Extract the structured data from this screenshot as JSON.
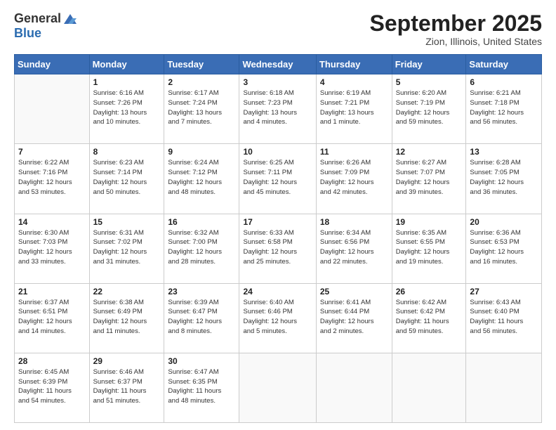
{
  "logo": {
    "general": "General",
    "blue": "Blue"
  },
  "title": "September 2025",
  "location": "Zion, Illinois, United States",
  "days_of_week": [
    "Sunday",
    "Monday",
    "Tuesday",
    "Wednesday",
    "Thursday",
    "Friday",
    "Saturday"
  ],
  "weeks": [
    [
      {
        "day": "",
        "info": ""
      },
      {
        "day": "1",
        "info": "Sunrise: 6:16 AM\nSunset: 7:26 PM\nDaylight: 13 hours\nand 10 minutes."
      },
      {
        "day": "2",
        "info": "Sunrise: 6:17 AM\nSunset: 7:24 PM\nDaylight: 13 hours\nand 7 minutes."
      },
      {
        "day": "3",
        "info": "Sunrise: 6:18 AM\nSunset: 7:23 PM\nDaylight: 13 hours\nand 4 minutes."
      },
      {
        "day": "4",
        "info": "Sunrise: 6:19 AM\nSunset: 7:21 PM\nDaylight: 13 hours\nand 1 minute."
      },
      {
        "day": "5",
        "info": "Sunrise: 6:20 AM\nSunset: 7:19 PM\nDaylight: 12 hours\nand 59 minutes."
      },
      {
        "day": "6",
        "info": "Sunrise: 6:21 AM\nSunset: 7:18 PM\nDaylight: 12 hours\nand 56 minutes."
      }
    ],
    [
      {
        "day": "7",
        "info": "Sunrise: 6:22 AM\nSunset: 7:16 PM\nDaylight: 12 hours\nand 53 minutes."
      },
      {
        "day": "8",
        "info": "Sunrise: 6:23 AM\nSunset: 7:14 PM\nDaylight: 12 hours\nand 50 minutes."
      },
      {
        "day": "9",
        "info": "Sunrise: 6:24 AM\nSunset: 7:12 PM\nDaylight: 12 hours\nand 48 minutes."
      },
      {
        "day": "10",
        "info": "Sunrise: 6:25 AM\nSunset: 7:11 PM\nDaylight: 12 hours\nand 45 minutes."
      },
      {
        "day": "11",
        "info": "Sunrise: 6:26 AM\nSunset: 7:09 PM\nDaylight: 12 hours\nand 42 minutes."
      },
      {
        "day": "12",
        "info": "Sunrise: 6:27 AM\nSunset: 7:07 PM\nDaylight: 12 hours\nand 39 minutes."
      },
      {
        "day": "13",
        "info": "Sunrise: 6:28 AM\nSunset: 7:05 PM\nDaylight: 12 hours\nand 36 minutes."
      }
    ],
    [
      {
        "day": "14",
        "info": "Sunrise: 6:30 AM\nSunset: 7:03 PM\nDaylight: 12 hours\nand 33 minutes."
      },
      {
        "day": "15",
        "info": "Sunrise: 6:31 AM\nSunset: 7:02 PM\nDaylight: 12 hours\nand 31 minutes."
      },
      {
        "day": "16",
        "info": "Sunrise: 6:32 AM\nSunset: 7:00 PM\nDaylight: 12 hours\nand 28 minutes."
      },
      {
        "day": "17",
        "info": "Sunrise: 6:33 AM\nSunset: 6:58 PM\nDaylight: 12 hours\nand 25 minutes."
      },
      {
        "day": "18",
        "info": "Sunrise: 6:34 AM\nSunset: 6:56 PM\nDaylight: 12 hours\nand 22 minutes."
      },
      {
        "day": "19",
        "info": "Sunrise: 6:35 AM\nSunset: 6:55 PM\nDaylight: 12 hours\nand 19 minutes."
      },
      {
        "day": "20",
        "info": "Sunrise: 6:36 AM\nSunset: 6:53 PM\nDaylight: 12 hours\nand 16 minutes."
      }
    ],
    [
      {
        "day": "21",
        "info": "Sunrise: 6:37 AM\nSunset: 6:51 PM\nDaylight: 12 hours\nand 14 minutes."
      },
      {
        "day": "22",
        "info": "Sunrise: 6:38 AM\nSunset: 6:49 PM\nDaylight: 12 hours\nand 11 minutes."
      },
      {
        "day": "23",
        "info": "Sunrise: 6:39 AM\nSunset: 6:47 PM\nDaylight: 12 hours\nand 8 minutes."
      },
      {
        "day": "24",
        "info": "Sunrise: 6:40 AM\nSunset: 6:46 PM\nDaylight: 12 hours\nand 5 minutes."
      },
      {
        "day": "25",
        "info": "Sunrise: 6:41 AM\nSunset: 6:44 PM\nDaylight: 12 hours\nand 2 minutes."
      },
      {
        "day": "26",
        "info": "Sunrise: 6:42 AM\nSunset: 6:42 PM\nDaylight: 11 hours\nand 59 minutes."
      },
      {
        "day": "27",
        "info": "Sunrise: 6:43 AM\nSunset: 6:40 PM\nDaylight: 11 hours\nand 56 minutes."
      }
    ],
    [
      {
        "day": "28",
        "info": "Sunrise: 6:45 AM\nSunset: 6:39 PM\nDaylight: 11 hours\nand 54 minutes."
      },
      {
        "day": "29",
        "info": "Sunrise: 6:46 AM\nSunset: 6:37 PM\nDaylight: 11 hours\nand 51 minutes."
      },
      {
        "day": "30",
        "info": "Sunrise: 6:47 AM\nSunset: 6:35 PM\nDaylight: 11 hours\nand 48 minutes."
      },
      {
        "day": "",
        "info": ""
      },
      {
        "day": "",
        "info": ""
      },
      {
        "day": "",
        "info": ""
      },
      {
        "day": "",
        "info": ""
      }
    ]
  ]
}
